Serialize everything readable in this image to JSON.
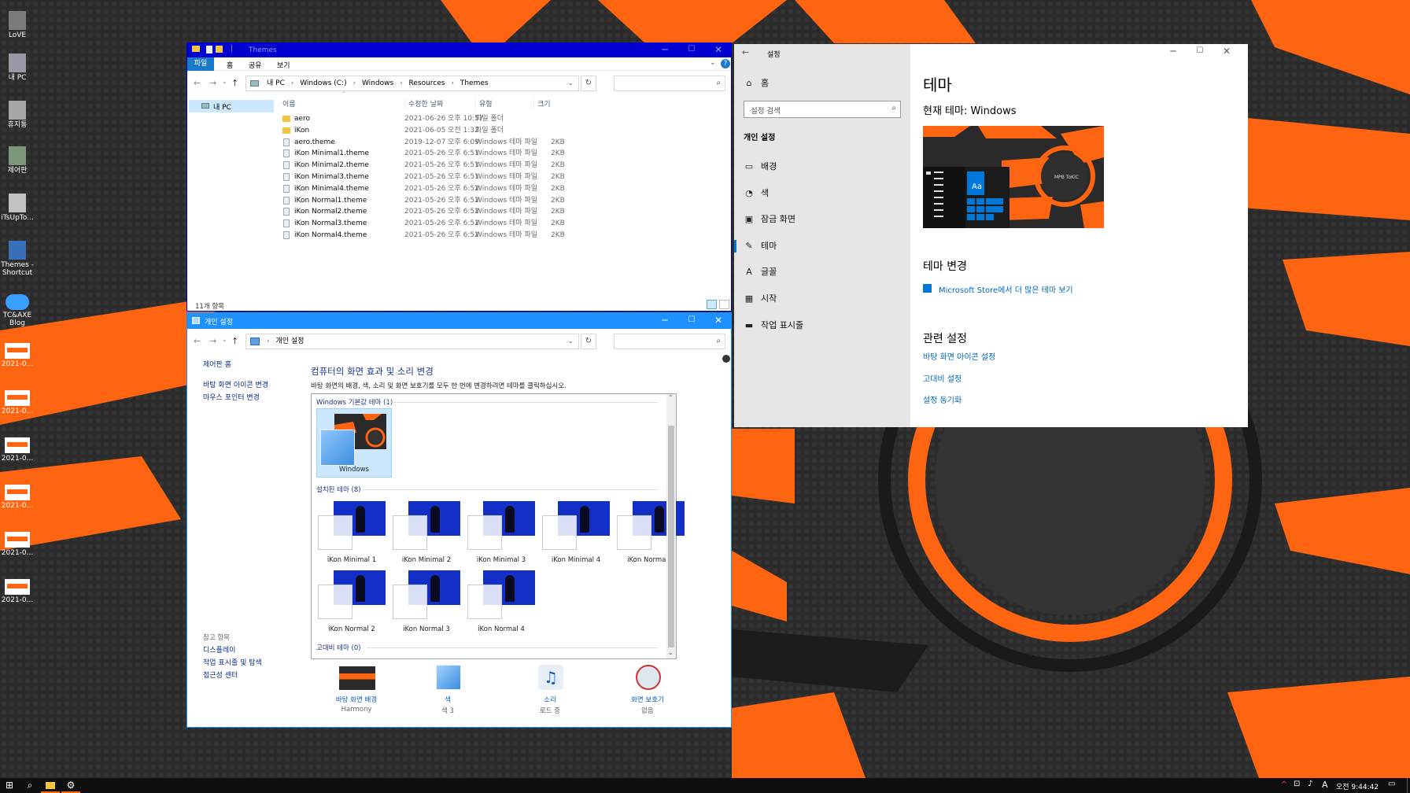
{
  "desktop": {
    "icons": [
      {
        "label": "LoVE",
        "icon": "user-icon"
      },
      {
        "label": "내 PC",
        "icon": "computer-icon"
      },
      {
        "label": "휴지통",
        "icon": "recycle-bin-icon"
      },
      {
        "label": "제어판",
        "icon": "control-panel-icon"
      },
      {
        "label": "iTsUpTo...",
        "icon": "document-icon"
      },
      {
        "label": "Themes - Shortcut",
        "icon": "themes-shortcut-icon"
      },
      {
        "label": "TC&AXE Blog",
        "icon": "cloud-icon"
      },
      {
        "label": "2021-0...",
        "icon": "image-file-icon"
      },
      {
        "label": "2021-0...",
        "icon": "image-file-icon"
      },
      {
        "label": "2021-0...",
        "icon": "image-file-icon"
      },
      {
        "label": "2021-0...",
        "icon": "image-file-icon"
      },
      {
        "label": "2021-0...",
        "icon": "image-file-icon"
      },
      {
        "label": "2021-0...",
        "icon": "image-file-icon"
      }
    ]
  },
  "explorer": {
    "title": "Themes",
    "title_sep": "|",
    "ribbon_tabs": [
      "파일",
      "홈",
      "공유",
      "보기"
    ],
    "breadcrumb": [
      "내 PC",
      "Windows (C:)",
      "Windows",
      "Resources",
      "Themes"
    ],
    "nav_item": "내 PC",
    "columns": {
      "name": "이름",
      "date": "수정한 날짜",
      "type": "유형",
      "size": "크기"
    },
    "files": [
      {
        "name": "aero",
        "date": "2021-06-26 오후 10:57",
        "type": "파일 폴더",
        "size": "",
        "kind": "folder"
      },
      {
        "name": "iKon",
        "date": "2021-06-05 오전 1:32",
        "type": "파일 폴더",
        "size": "",
        "kind": "folder"
      },
      {
        "name": "aero.theme",
        "date": "2019-12-07 오후 6:09",
        "type": "Windows 테마 파일",
        "size": "2KB",
        "kind": "file"
      },
      {
        "name": "iKon Minimal1.theme",
        "date": "2021-05-26 오후 6:51",
        "type": "Windows 테마 파일",
        "size": "2KB",
        "kind": "file"
      },
      {
        "name": "iKon Minimal2.theme",
        "date": "2021-05-26 오후 6:51",
        "type": "Windows 테마 파일",
        "size": "2KB",
        "kind": "file"
      },
      {
        "name": "iKon Minimal3.theme",
        "date": "2021-05-26 오후 6:51",
        "type": "Windows 테마 파일",
        "size": "2KB",
        "kind": "file"
      },
      {
        "name": "iKon Minimal4.theme",
        "date": "2021-05-26 오후 6:52",
        "type": "Windows 테마 파일",
        "size": "2KB",
        "kind": "file"
      },
      {
        "name": "iKon Normal1.theme",
        "date": "2021-05-26 오후 6:52",
        "type": "Windows 테마 파일",
        "size": "2KB",
        "kind": "file"
      },
      {
        "name": "iKon Normal2.theme",
        "date": "2021-05-26 오후 6:52",
        "type": "Windows 테마 파일",
        "size": "2KB",
        "kind": "file"
      },
      {
        "name": "iKon Normal3.theme",
        "date": "2021-05-26 오후 6:52",
        "type": "Windows 테마 파일",
        "size": "2KB",
        "kind": "file"
      },
      {
        "name": "iKon Normal4.theme",
        "date": "2021-05-26 오후 6:52",
        "type": "Windows 테마 파일",
        "size": "2KB",
        "kind": "file"
      }
    ],
    "status": "11개 항목"
  },
  "personalize": {
    "title": "개인 설정",
    "breadcrumb": "개인 설정",
    "side_home": "제어판 홈",
    "side_links": [
      "바탕 화면 아이콘 변경",
      "마우스 포인터 변경"
    ],
    "see_also_title": "참고 항목",
    "see_also": [
      "디스플레이",
      "작업 표시줄 및 탐색",
      "접근성 센터"
    ],
    "heading": "컴퓨터의 화면 효과 및 소리 변경",
    "subtitle": "바탕 화면의 배경, 색, 소리 및 화면 보호기를 모두 한 번에 변경하려면 테마를 클릭하십시오.",
    "group_default": "Windows 기본값 테마 (1)",
    "default_theme": "Windows",
    "group_installed": "설치된 테마 (8)",
    "installed_themes": [
      "iKon Minimal 1",
      "iKon Minimal 2",
      "iKon Minimal 3",
      "iKon Minimal 4",
      "iKon Normal 1",
      "iKon Normal 2",
      "iKon Normal 3",
      "iKon Normal 4"
    ],
    "group_contrast": "고대비 테마 (0)",
    "bottom": [
      {
        "title": "바탕 화면 배경",
        "value": "Harmony",
        "icon": "wallpaper-icon"
      },
      {
        "title": "색",
        "value": "색 3",
        "icon": "color-icon"
      },
      {
        "title": "소리",
        "value": "로드 중",
        "icon": "sound-icon"
      },
      {
        "title": "화면 보호기",
        "value": "없음",
        "icon": "screensaver-icon"
      }
    ]
  },
  "settings": {
    "title": "설정",
    "home": "홈",
    "search_placeholder": "설정 검색",
    "section": "개인 설정",
    "nav": [
      {
        "label": "배경",
        "icon": "image-icon"
      },
      {
        "label": "색",
        "icon": "palette-icon"
      },
      {
        "label": "잠금 화면",
        "icon": "lock-screen-icon"
      },
      {
        "label": "테마",
        "icon": "theme-icon",
        "active": true
      },
      {
        "label": "글꼴",
        "icon": "font-icon"
      },
      {
        "label": "시작",
        "icon": "start-icon"
      },
      {
        "label": "작업 표시줄",
        "icon": "taskbar-icon"
      }
    ],
    "page_title": "테마",
    "current_theme": "현재 테마: Windows",
    "preview_badge": "MPB ToKiC",
    "preview_aa": "Aa",
    "change_title": "테마 변경",
    "store_link": "Microsoft Store에서 더 많은 테마 보기",
    "related_title": "관련 설정",
    "related_links": [
      "바탕 화면 아이콘 설정",
      "고대비 설정",
      "설정 동기화"
    ]
  },
  "taskbar": {
    "clock_time": "오전 9:44:42",
    "ime": "A",
    "accent": "#ff6a00"
  },
  "colors": {
    "explorer_title": "#0000d0",
    "personalize_title": "#1e90ff",
    "accent": "#0078d7",
    "wallpaper_orange": "#ff6410"
  }
}
